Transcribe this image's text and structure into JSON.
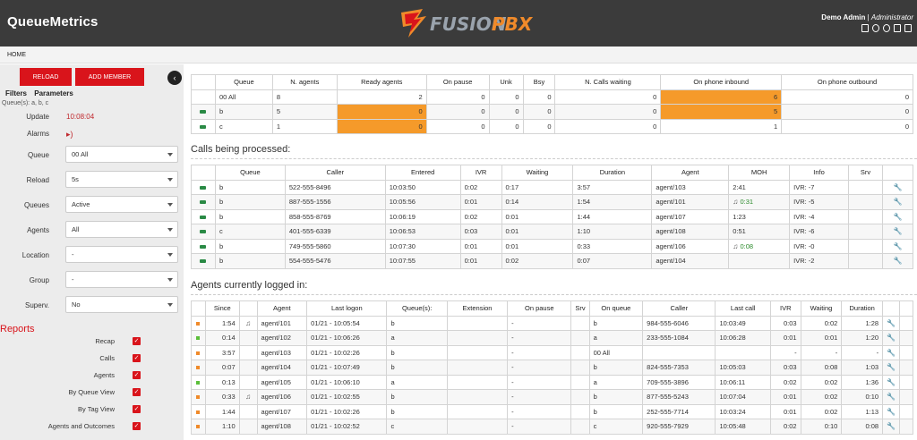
{
  "header": {
    "brand": "QueueMetrics",
    "logo_word1": "FUSION",
    "logo_word2": "PBX",
    "user_name": "Demo Admin",
    "user_sep": " | ",
    "user_role": "Administrator"
  },
  "menu": {
    "home": "HOME"
  },
  "sidebar": {
    "reload_label": "RELOAD",
    "add_member_label": "ADD MEMBER",
    "collapse_glyph": "‹",
    "tabs": [
      "Filters",
      "Parameters"
    ],
    "queues_line": "Queue(s): a, b, c",
    "update_label": "Update",
    "update_value": "10:08:04",
    "alarms_label": "Alarms",
    "filters": [
      {
        "label": "Queue",
        "value": "00 All"
      },
      {
        "label": "Reload",
        "value": "5s"
      },
      {
        "label": "Queues",
        "value": "Active"
      },
      {
        "label": "Agents",
        "value": "All"
      },
      {
        "label": "Location",
        "value": "-"
      },
      {
        "label": "Group",
        "value": "-"
      },
      {
        "label": "Superv.",
        "value": "No"
      }
    ],
    "reports_title": "Reports",
    "reports": [
      "Recap",
      "Calls",
      "Agents",
      "By Queue View",
      "By Tag View",
      "Agents and Outcomes"
    ]
  },
  "queue_table": {
    "headers": [
      "",
      "Queue",
      "N. agents",
      "Ready agents",
      "On pause",
      "Unk",
      "Bsy",
      "N. Calls waiting",
      "On phone inbound",
      "On phone outbound"
    ],
    "rows": [
      [
        "",
        "00 All",
        "8",
        "2",
        "0",
        "0",
        "0",
        "0",
        "6",
        "0"
      ],
      [
        "phone",
        "b",
        "5",
        "0",
        "0",
        "0",
        "0",
        "0",
        "5",
        "0"
      ],
      [
        "phone",
        "c",
        "1",
        "0",
        "0",
        "0",
        "0",
        "0",
        "1",
        "0"
      ]
    ]
  },
  "calls_title": "Calls being processed:",
  "calls_table": {
    "headers": [
      "",
      "Queue",
      "Caller",
      "Entered",
      "IVR",
      "Waiting",
      "Duration",
      "Agent",
      "MOH",
      "Info",
      "Srv",
      ""
    ],
    "rows": [
      [
        "b",
        "522-555-8496",
        "10:03:50",
        "0:02",
        "0:17",
        "3:57",
        "agent/103",
        "2:41",
        "IVR: -7",
        ""
      ],
      [
        "b",
        "887-555-1556",
        "10:05:56",
        "0:01",
        "0:14",
        "1:54",
        "agent/101",
        "0:31",
        "IVR: -5",
        ""
      ],
      [
        "b",
        "858-555-8769",
        "10:06:19",
        "0:02",
        "0:01",
        "1:44",
        "agent/107",
        "1:23",
        "IVR: -4",
        ""
      ],
      [
        "c",
        "401-555-6339",
        "10:06:53",
        "0:03",
        "0:01",
        "1:10",
        "agent/108",
        "0:51",
        "IVR: -6",
        ""
      ],
      [
        "b",
        "749-555-5860",
        "10:07:30",
        "0:01",
        "0:01",
        "0:33",
        "agent/106",
        "0:08",
        "IVR: -0",
        ""
      ],
      [
        "b",
        "554-555-5476",
        "10:07:55",
        "0:01",
        "0:02",
        "0:07",
        "agent/104",
        "",
        "IVR: -2",
        ""
      ]
    ]
  },
  "agents_title": "Agents currently logged in:",
  "agents_table": {
    "headers": [
      "",
      "Since",
      "",
      "Agent",
      "Last logon",
      "Queue(s):",
      "Extension",
      "On pause",
      "Srv",
      "On queue",
      "Caller",
      "Last call",
      "IVR",
      "Waiting",
      "Duration",
      "",
      ""
    ],
    "rows": [
      [
        "orange",
        "1:54",
        "note",
        "agent/101",
        "01/21 - 10:05:54",
        "b",
        "",
        "-",
        "",
        "b",
        "984-555-6046",
        "10:03:49",
        "0:03",
        "0:02",
        "1:28"
      ],
      [
        "green",
        "0:14",
        "",
        "agent/102",
        "01/21 - 10:06:26",
        "a",
        "",
        "-",
        "",
        "a",
        "233-555-1084",
        "10:06:28",
        "0:01",
        "0:01",
        "1:20"
      ],
      [
        "orange",
        "3:57",
        "",
        "agent/103",
        "01/21 - 10:02:26",
        "b",
        "",
        "-",
        "",
        "00 All",
        "",
        "",
        "-",
        "-",
        "-"
      ],
      [
        "orange",
        "0:07",
        "",
        "agent/104",
        "01/21 - 10:07:49",
        "b",
        "",
        "-",
        "",
        "b",
        "824-555-7353",
        "10:05:03",
        "0:03",
        "0:08",
        "1:03"
      ],
      [
        "green",
        "0:13",
        "",
        "agent/105",
        "01/21 - 10:06:10",
        "a",
        "",
        "-",
        "",
        "a",
        "709-555-3896",
        "10:06:11",
        "0:02",
        "0:02",
        "1:36"
      ],
      [
        "orange",
        "0:33",
        "note",
        "agent/106",
        "01/21 - 10:02:55",
        "b",
        "",
        "-",
        "",
        "b",
        "877-555-5243",
        "10:07:04",
        "0:01",
        "0:02",
        "0:10"
      ],
      [
        "orange",
        "1:44",
        "",
        "agent/107",
        "01/21 - 10:02:26",
        "b",
        "",
        "-",
        "",
        "b",
        "252-555-7714",
        "10:03:24",
        "0:01",
        "0:02",
        "1:13"
      ],
      [
        "orange",
        "1:10",
        "",
        "agent/108",
        "01/21 - 10:02:52",
        "c",
        "",
        "-",
        "",
        "c",
        "920-555-7929",
        "10:05:48",
        "0:02",
        "0:10",
        "0:08"
      ]
    ]
  },
  "colors": {
    "topbar": "#3b3b3b",
    "accent_red": "#d9141b",
    "highlight_orange": "#f59a2a",
    "status_green": "#5cbf3a"
  },
  "icons": {
    "phone": "phone-icon",
    "wrench": "wrench-icon",
    "note": "music-note-icon",
    "alarm": "speaker-icon"
  }
}
